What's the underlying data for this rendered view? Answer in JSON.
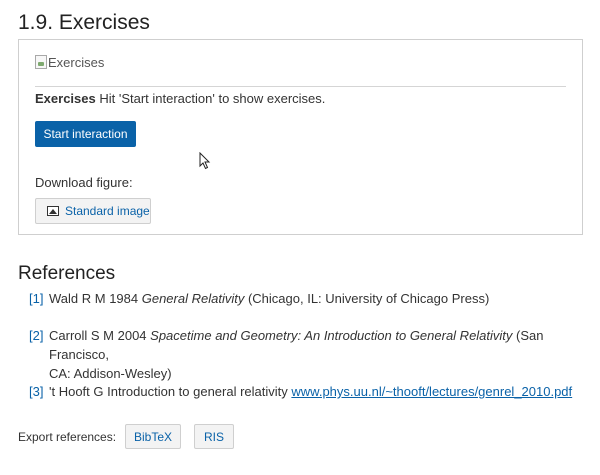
{
  "section": {
    "title": "1.9. Exercises"
  },
  "exercise": {
    "image_alt": "Exercises",
    "caption_bold": "Exercises",
    "caption_text": " Hit 'Start interaction' to show exercises.",
    "start_button": "Start interaction",
    "download_label": "Download figure:",
    "standard_image_button": "Standard image"
  },
  "references": {
    "title": "References",
    "items": [
      {
        "num": "[1]",
        "before": "Wald R M 1984 ",
        "italic": "General Relativity",
        "after_line1": "  (Chicago, IL: University of Chicago Press)",
        "line2": ""
      },
      {
        "num": "[2]",
        "before": "Carroll S M 2004 ",
        "italic": "Spacetime and Geometry: An Introduction to General Relativity",
        "after_line1": "  (San Francisco,",
        "line2": "CA: Addison-Wesley)"
      },
      {
        "num": "[3]",
        "before": "'t Hooft G Introduction to general relativity ",
        "link": "www.phys.uu.nl/~thooft/lectures/genrel_2010.pdf"
      }
    ]
  },
  "export": {
    "label": "Export references:",
    "bibtex": "BibTeX",
    "ris": "RIS"
  },
  "colors": {
    "accent": "#0a62a8",
    "border": "#cfcfcf",
    "button_bg": "#f3f3f3"
  }
}
